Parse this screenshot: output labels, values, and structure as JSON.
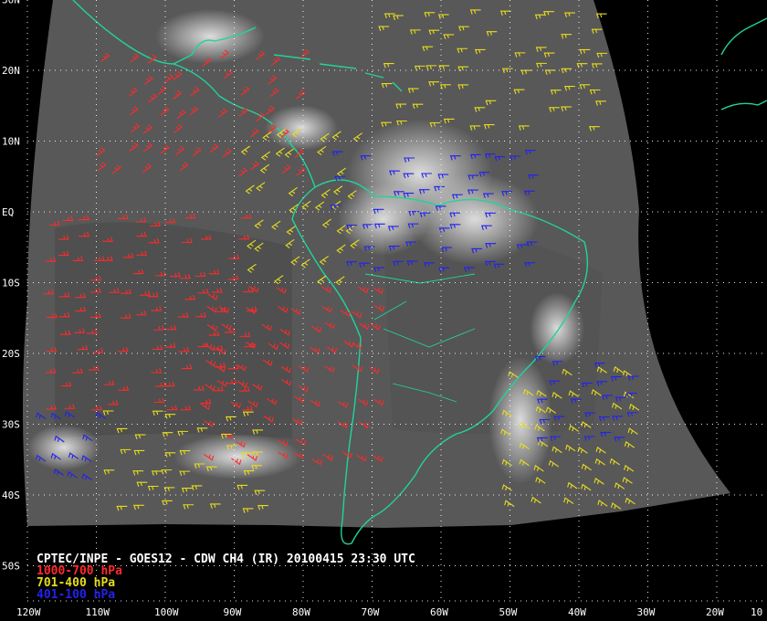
{
  "colors": {
    "background": "#000000",
    "coastline": "#22d39a",
    "grid": "#ffffff",
    "cloud": "#e6e6e6",
    "sea_ir": "#5a5a5a",
    "low_level": "#ff2a2a",
    "mid_level": "#e6dc1e",
    "high_level": "#1e1edc"
  },
  "map": {
    "projection": "satellite IR swath",
    "lat_ticks": [
      "30N",
      "20N",
      "10N",
      "EQ",
      "10S",
      "20S",
      "30S",
      "40S",
      "50S"
    ],
    "lon_ticks": [
      "120W",
      "110W",
      "100W",
      "90W",
      "80W",
      "70W",
      "60W",
      "50W",
      "40W",
      "30W",
      "20W",
      "10"
    ],
    "grid": "dotted"
  },
  "caption": {
    "title": "CPTEC/INPE - GOES12 - CDW CH4 (IR) 20100415 23:30 UTC",
    "legend": [
      {
        "label": "1000-700 hPa",
        "color": "#ff2a2a",
        "key": "low"
      },
      {
        "label": "701-400 hPa",
        "color": "#e6dc1e",
        "key": "mid"
      },
      {
        "label": "401-100 hPa",
        "color": "#2222ee",
        "key": "high"
      }
    ]
  },
  "wind_regions": [
    {
      "key": "low",
      "lon": [
        -118,
        -88
      ],
      "lat": [
        -28,
        0
      ],
      "dir": "E"
    },
    {
      "key": "low",
      "lon": [
        -110,
        -80
      ],
      "lat": [
        5,
        22
      ],
      "dir": "NE"
    },
    {
      "key": "low",
      "lon": [
        -95,
        -70
      ],
      "lat": [
        -35,
        -10
      ],
      "dir": "SE"
    },
    {
      "key": "mid",
      "lon": [
        -88,
        -72
      ],
      "lat": [
        -10,
        12
      ],
      "dir": "SW"
    },
    {
      "key": "mid",
      "lon": [
        -70,
        -35
      ],
      "lat": [
        12,
        30
      ],
      "dir": "W"
    },
    {
      "key": "mid",
      "lon": [
        -108,
        -85
      ],
      "lat": [
        -42,
        -28
      ],
      "dir": "W"
    },
    {
      "key": "mid",
      "lon": [
        -50,
        -32
      ],
      "lat": [
        -42,
        -22
      ],
      "dir": "NW"
    },
    {
      "key": "high",
      "lon": [
        -75,
        -45
      ],
      "lat": [
        -8,
        8
      ],
      "dir": "W"
    },
    {
      "key": "high",
      "lon": [
        -45,
        -30
      ],
      "lat": [
        -32,
        -20
      ],
      "dir": "W"
    },
    {
      "key": "high",
      "lon": [
        -118,
        -108
      ],
      "lat": [
        -38,
        -28
      ],
      "dir": "NW"
    }
  ]
}
